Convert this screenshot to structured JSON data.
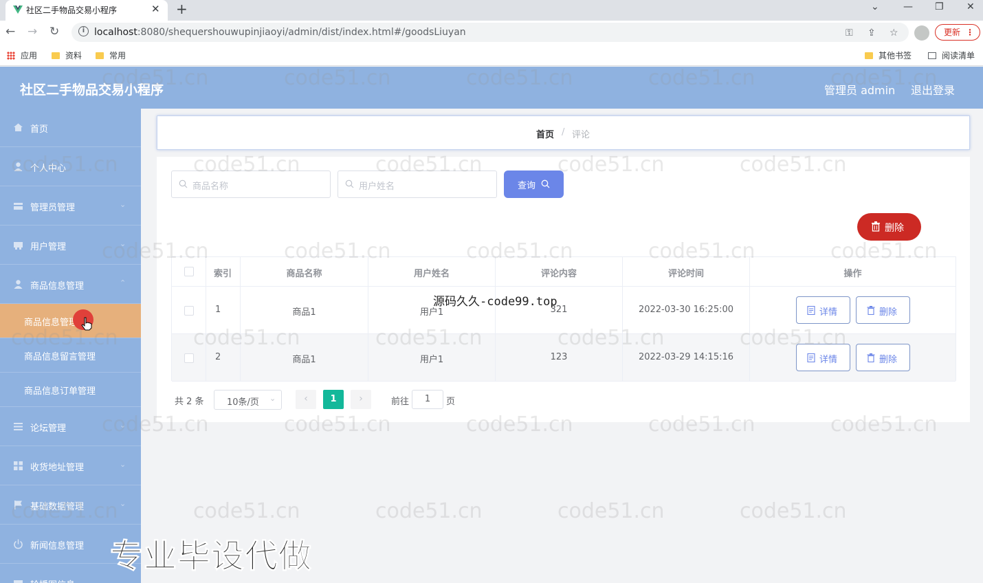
{
  "browser": {
    "tab_title": "社区二手物品交易小程序",
    "url_host": "localhost",
    "url_rest": ":8080/shequershouwupinjiaoyi/admin/dist/index.html#/goodsLiuyan",
    "update_label": "更新",
    "bookmarks": [
      "应用",
      "资料",
      "常用"
    ],
    "bookmarks_right": [
      "其他书签",
      "阅读清单"
    ]
  },
  "header": {
    "title": "社区二手物品交易小程序",
    "admin": "管理员 admin",
    "logout": "退出登录"
  },
  "sidebar": {
    "items": [
      {
        "label": "首页",
        "icon": "home-icon"
      },
      {
        "label": "个人中心",
        "icon": "user-icon"
      },
      {
        "label": "管理员管理",
        "icon": "admin-icon"
      },
      {
        "label": "用户管理",
        "icon": "users-icon"
      },
      {
        "label": "商品信息管理",
        "icon": "goods-icon"
      },
      {
        "label": "论坛管理",
        "icon": "forum-icon"
      },
      {
        "label": "收货地址管理",
        "icon": "address-icon"
      },
      {
        "label": "基础数据管理",
        "icon": "flag-icon"
      },
      {
        "label": "新闻信息管理",
        "icon": "power-icon"
      },
      {
        "label": "轮播图信息",
        "icon": "carousel-icon"
      }
    ],
    "submenu": [
      {
        "label": "商品信息管理",
        "active": true
      },
      {
        "label": "商品信息留言管理",
        "active": false
      },
      {
        "label": "商品信息订单管理",
        "active": false
      }
    ]
  },
  "breadcrumb": {
    "home": "首页",
    "sep": "/",
    "current": "评论"
  },
  "search": {
    "goods_placeholder": "商品名称",
    "user_placeholder": "用户姓名",
    "query_label": "查询"
  },
  "actions": {
    "delete_label": "删除"
  },
  "table": {
    "headers": [
      "索引",
      "商品名称",
      "用户姓名",
      "评论内容",
      "评论时间",
      "操作"
    ],
    "rows": [
      {
        "index": "1",
        "goods": "商品1",
        "user": "用户1",
        "content": "321",
        "time": "2022-03-30 16:25:00"
      },
      {
        "index": "2",
        "goods": "商品1",
        "user": "用户1",
        "content": "123",
        "time": "2022-03-29 14:15:16"
      }
    ],
    "detail_label": "详情",
    "delete_label": "删除"
  },
  "pagination": {
    "total": "共 2 条",
    "page_size": "10条/页",
    "current_page": "1",
    "goto_label": "前往",
    "goto_value": "1",
    "goto_suffix": "页"
  },
  "overlays": {
    "watermark": "code51.cn",
    "mid_text": "源码久久-code99.top",
    "big_text": "专业毕设代做"
  },
  "colors": {
    "sidebar_bg": "#8fb2e0",
    "active_submenu": "#e6b07c",
    "primary": "#6b86e8",
    "danger": "#cc2a24",
    "page_active": "#13b89a"
  }
}
